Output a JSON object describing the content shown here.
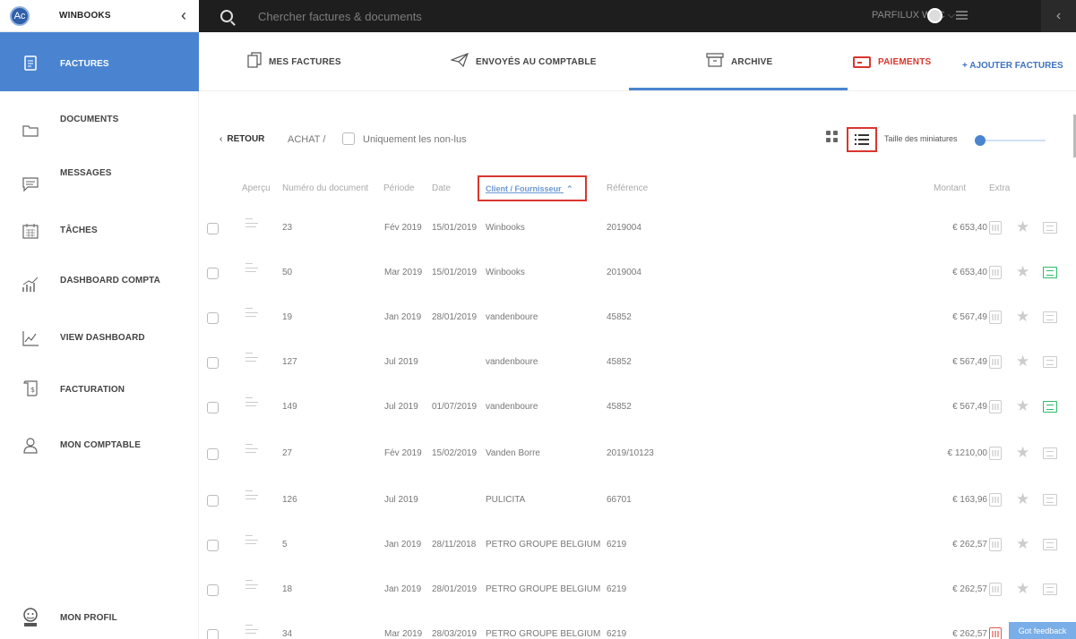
{
  "header": {
    "logo_text": "Ac",
    "brand": "WINBOOKS",
    "search_placeholder": "Chercher factures & documents",
    "company": "PARFILUX WBC ⌵"
  },
  "sidebar": {
    "items": [
      {
        "label": "FACTURES",
        "icon": "invoice-icon"
      },
      {
        "label": "DOCUMENTS",
        "icon": "folder-icon"
      },
      {
        "label": "MESSAGES",
        "icon": "message-icon"
      },
      {
        "label": "TÂCHES",
        "icon": "calendar-icon"
      },
      {
        "label": "DASHBOARD COMPTA",
        "icon": "chart-icon"
      },
      {
        "label": "VIEW DASHBOARD",
        "icon": "line-chart-icon"
      },
      {
        "label": "FACTURATION",
        "icon": "billing-icon"
      },
      {
        "label": "MON COMPTABLE",
        "icon": "person-icon"
      },
      {
        "label": "MON PROFIL",
        "icon": "profile-icon"
      }
    ]
  },
  "tabs": {
    "mes_factures": "MES FACTURES",
    "envoyes": "ENVOYÉS AU COMPTABLE",
    "archive": "ARCHIVE",
    "paiements": "PAIEMENTS",
    "add": "+ AJOUTER FACTURES"
  },
  "toolbar": {
    "back": "RETOUR",
    "crumb": "ACHAT /",
    "unread": "Uniquement les non-lus",
    "thumb_size": "Taille des miniatures"
  },
  "table": {
    "headers": {
      "apercu": "Aperçu",
      "numero": "Numéro du document",
      "periode": "Période",
      "date": "Date",
      "client": "Client / Fournisseur",
      "reference": "Référence",
      "montant": "Montant",
      "extra": "Extra"
    },
    "rows": [
      {
        "num": "23",
        "periode": "Fév 2019",
        "date": "15/01/2019",
        "client": "Winbooks",
        "ref": "2019004",
        "montant": "€ 653,40",
        "msg": "grey",
        "cal": "grey"
      },
      {
        "num": "50",
        "periode": "Mar 2019",
        "date": "15/01/2019",
        "client": "Winbooks",
        "ref": "2019004",
        "montant": "€ 653,40",
        "msg": "green",
        "cal": "grey"
      },
      {
        "num": "19",
        "periode": "Jan 2019",
        "date": "28/01/2019",
        "client": "vandenboure",
        "ref": "45852",
        "montant": "€ 567,49",
        "msg": "grey",
        "cal": "grey"
      },
      {
        "num": "127",
        "periode": "Jul 2019",
        "date": "",
        "client": "vandenboure",
        "ref": "45852",
        "montant": "€ 567,49",
        "msg": "grey",
        "cal": "grey"
      },
      {
        "num": "149",
        "periode": "Jul 2019",
        "date": "01/07/2019",
        "client": "vandenboure",
        "ref": "45852",
        "montant": "€ 567,49",
        "msg": "green",
        "cal": "grey"
      },
      {
        "num": "27",
        "periode": "Fév 2019",
        "date": "15/02/2019",
        "client": "Vanden Borre",
        "ref": "2019/10123",
        "montant": "€ 1210,00",
        "msg": "grey",
        "cal": "grey"
      },
      {
        "num": "126",
        "periode": "Jul 2019",
        "date": "",
        "client": "PULICITA",
        "ref": "66701",
        "montant": "€ 163,96",
        "msg": "grey",
        "cal": "grey"
      },
      {
        "num": "5",
        "periode": "Jan 2019",
        "date": "28/11/2018",
        "client": "PETRO GROUPE BELGIUM",
        "ref": "6219",
        "montant": "€ 262,57",
        "msg": "grey",
        "cal": "grey"
      },
      {
        "num": "18",
        "periode": "Jan 2019",
        "date": "28/01/2019",
        "client": "PETRO GROUPE BELGIUM",
        "ref": "6219",
        "montant": "€ 262,57",
        "msg": "grey",
        "cal": "grey"
      },
      {
        "num": "34",
        "periode": "Mar 2019",
        "date": "28/03/2019",
        "client": "PETRO GROUPE BELGIUM",
        "ref": "6219",
        "montant": "€ 262,57",
        "msg": "grey",
        "cal": "red"
      }
    ]
  },
  "feedback": "Got feedback"
}
